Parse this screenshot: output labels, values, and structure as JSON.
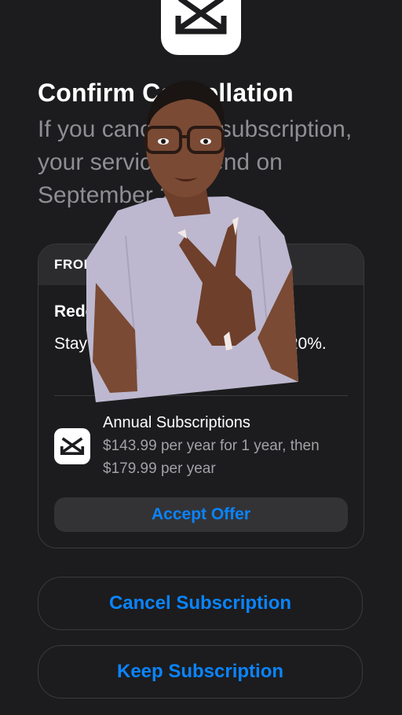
{
  "app": {
    "name": "CapCut",
    "icon": "capcut-logo-icon"
  },
  "dialog": {
    "title": "Confirm Cancellation",
    "subtitle": "If you cancel this subscription, your service will end on September 2."
  },
  "offer": {
    "header": "FROM CAPCUT",
    "headline": "Redeem Special Offer",
    "body": "Stay subscribed and save up to 20%.",
    "product_name": "Annual Subscriptions",
    "product_price": "$143.99 per year for 1 year, then $179.99 per year",
    "accept_label": "Accept Offer"
  },
  "actions": {
    "cancel_label": "Cancel Subscription",
    "keep_label": "Keep Subscription"
  },
  "colors": {
    "background": "#1c1c1e",
    "accent": "#0a84ff",
    "secondary_text": "#8e8e93"
  }
}
